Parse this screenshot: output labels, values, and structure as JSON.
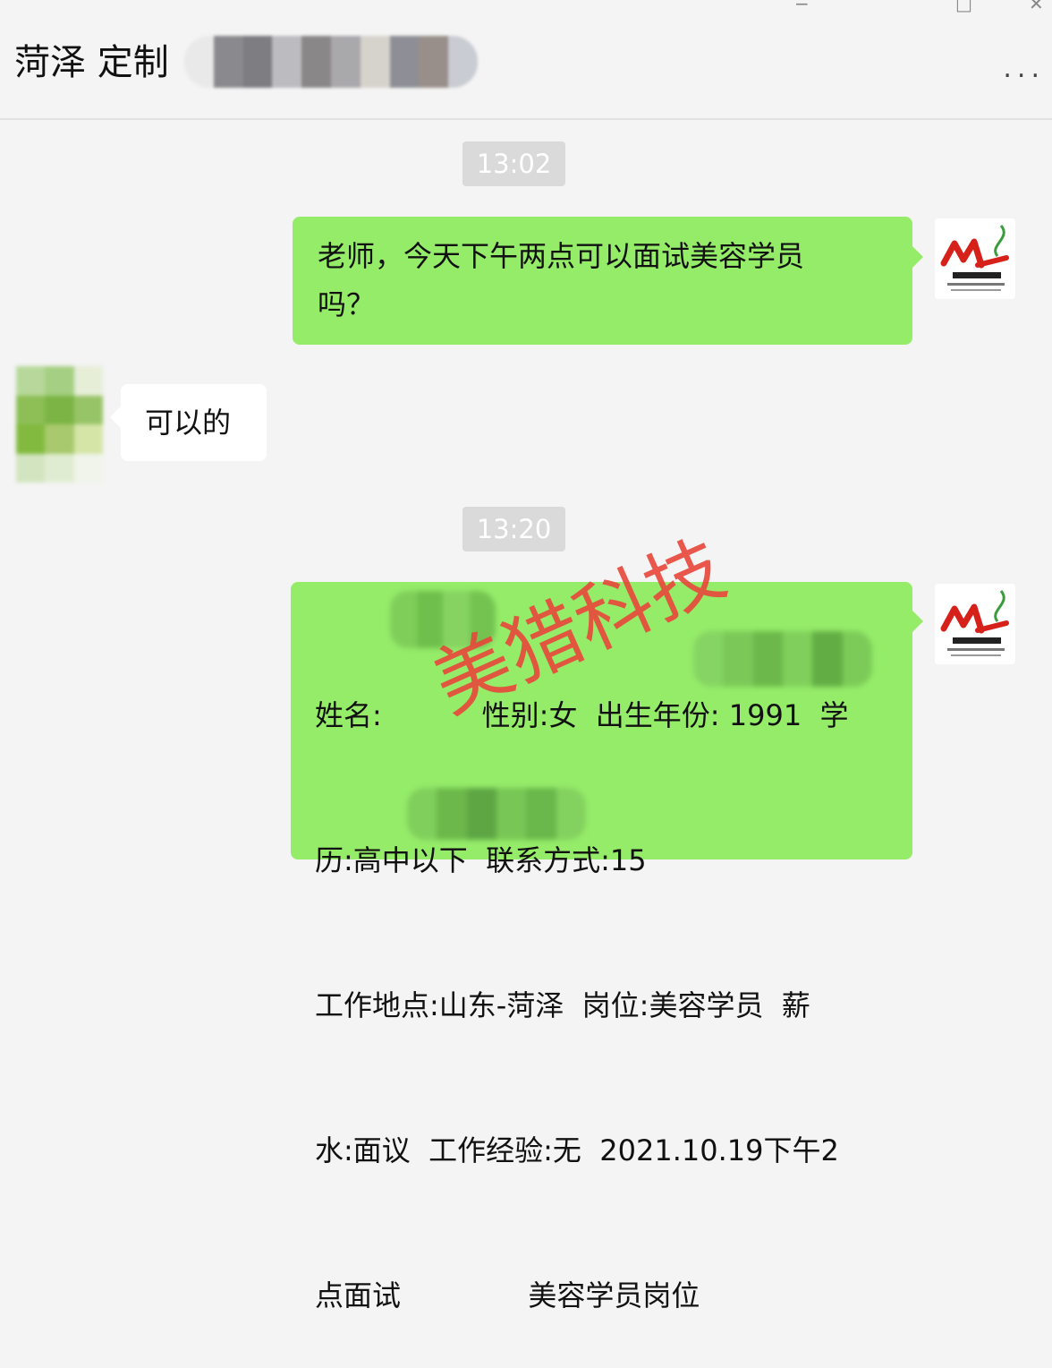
{
  "header": {
    "title": "菏泽 定制",
    "more_label": "...",
    "window_controls": [
      "minimize-icon",
      "maximize-icon",
      "close-icon"
    ]
  },
  "messages": [
    {
      "type": "timestamp",
      "text": "13:02"
    },
    {
      "type": "text",
      "sender": "self",
      "text": "老师，今天下午两点可以面试美容学员\n吗？"
    },
    {
      "type": "text",
      "sender": "other",
      "text": "可以的"
    },
    {
      "type": "timestamp",
      "text": "13:20"
    },
    {
      "type": "text",
      "sender": "self",
      "lines": [
        "姓名:           性别:女  出生年份: 1991  学",
        "历:高中以下  联系方式:15",
        "工作地点:山东-菏泽  岗位:美容学员  薪",
        "水:面议  工作经验:无  2021.10.19下午2",
        "点面试              美容学员岗位"
      ]
    }
  ],
  "watermark": {
    "text": "美猎科技"
  },
  "colors": {
    "self_bubble": "#95ec69",
    "other_bubble": "#ffffff",
    "background": "#f4f4f4",
    "timestamp_bg": "#dadada",
    "watermark": "#e8463a"
  }
}
